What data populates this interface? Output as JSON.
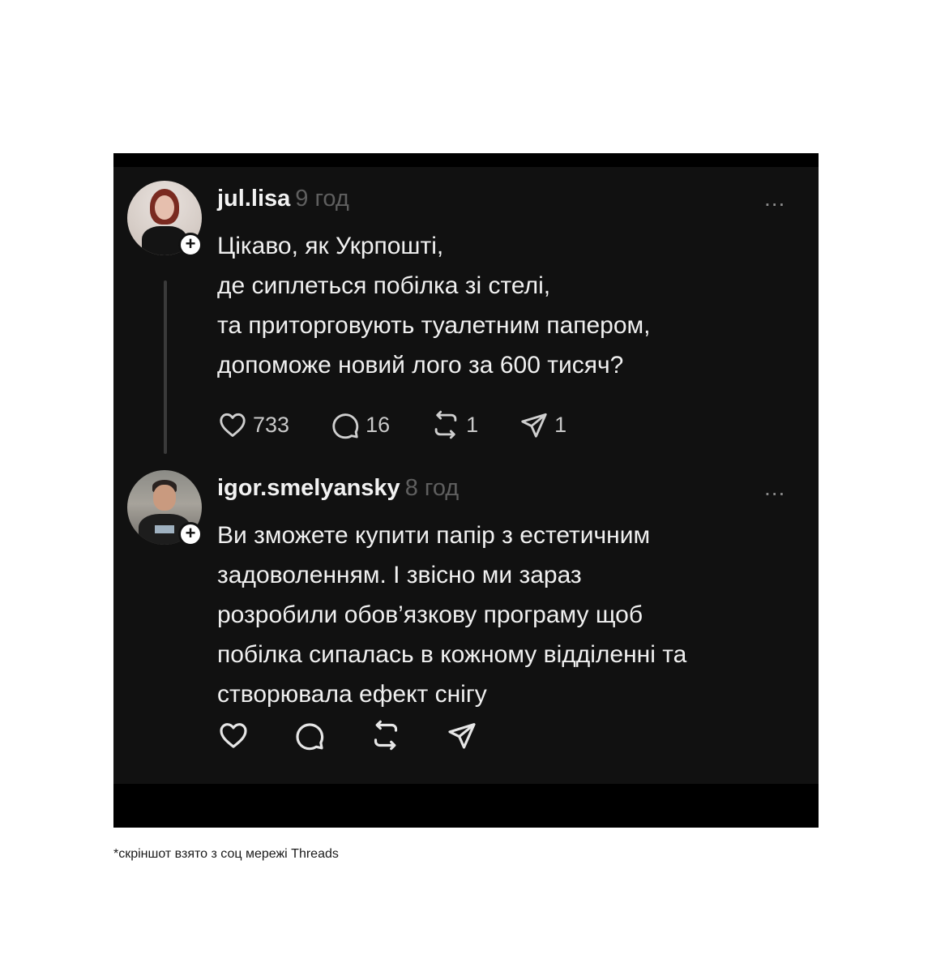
{
  "posts": [
    {
      "username": "jul.lisa",
      "time": "9 год",
      "more": "...",
      "lines": [
        "Цікаво, як Укрпошті,",
        "де сиплеться побілка зі стелі,",
        "та приторговують туалетним папером,",
        "допоможе новий лого за 600 тисяч?"
      ],
      "likes": "733",
      "comments": "16",
      "reposts": "1",
      "shares": "1"
    },
    {
      "username": "igor.smelyansky",
      "time": "8 год",
      "more": "...",
      "lines": [
        "Ви зможете купити папір з естетичним",
        "задоволенням. І звісно ми зараз",
        "розробили обов’язкову програму щоб",
        "побілка сипалась в кожному відділенні та",
        "створювала ефект снігу"
      ]
    }
  ],
  "plus": "+",
  "caption": "*скріншот взято з соц мережі Threads",
  "icons": [
    "heart-icon",
    "comment-icon",
    "repost-icon",
    "share-icon",
    "more-icon",
    "plus-icon"
  ],
  "colors": {
    "background": "#111111",
    "text": "#f0f0f0",
    "muted": "#5f5f5f"
  }
}
